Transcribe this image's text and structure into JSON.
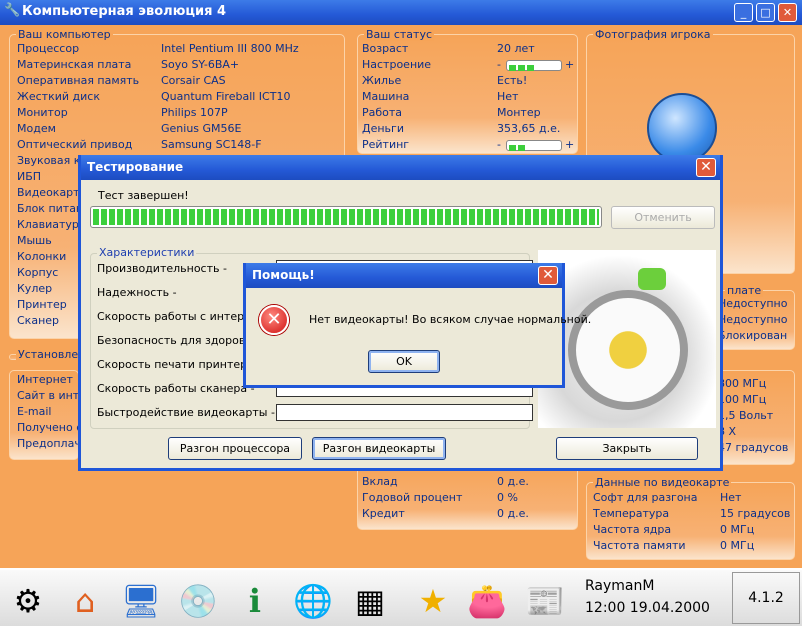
{
  "app": {
    "title": "Компьютерная эволюция 4"
  },
  "computer": {
    "title": "Ваш компьютер",
    "items": [
      {
        "label": "Процессор",
        "value": "Intel Pentium III 800 MHz"
      },
      {
        "label": "Материнская плата",
        "value": "Soyo SY-6BA+"
      },
      {
        "label": "Оперативная память",
        "value": "Corsair CAS"
      },
      {
        "label": "Жесткий диск",
        "value": "Quantum Fireball ICT10"
      },
      {
        "label": "Монитор",
        "value": "Philips 107P"
      },
      {
        "label": "Модем",
        "value": "Genius GM56E"
      },
      {
        "label": "Оптический привод",
        "value": "Samsung SC148-F"
      },
      {
        "label": "Звуковая ка",
        "value": ""
      },
      {
        "label": "ИБП",
        "value": ""
      },
      {
        "label": "Видеокарта",
        "value": ""
      },
      {
        "label": "Блок питан",
        "value": ""
      },
      {
        "label": "Клавиатура",
        "value": ""
      },
      {
        "label": "Мышь",
        "value": ""
      },
      {
        "label": "Колонки",
        "value": ""
      },
      {
        "label": "Корпус",
        "value": ""
      },
      {
        "label": "Кулер",
        "value": ""
      },
      {
        "label": "Принтер",
        "value": ""
      },
      {
        "label": "Сканер",
        "value": ""
      }
    ]
  },
  "installed": {
    "title": "Установлен"
  },
  "internet": {
    "items": [
      "Интернет",
      "Сайт в инте",
      "E-mail",
      "Получено с",
      "Предоплач"
    ]
  },
  "status": {
    "title": "Ваш статус",
    "items": [
      {
        "label": "Возраст",
        "value": "20 лет"
      },
      {
        "label": "Настроение",
        "bar": 3
      },
      {
        "label": "Жилье",
        "value": "Есть!"
      },
      {
        "label": "Машина",
        "value": "Нет"
      },
      {
        "label": "Работа",
        "value": "Монтер"
      },
      {
        "label": "Деньги",
        "value": "353,65 д.е."
      },
      {
        "label": "Рейтинг",
        "bar": 2
      }
    ],
    "minus": "-",
    "plus": "+"
  },
  "photo": {
    "title": "Фотография игрока"
  },
  "board": {
    "title": "плате",
    "values": [
      "Недоступно",
      "Недоступно",
      "Блокирован"
    ]
  },
  "cpu": {
    "values": [
      "800 МГц",
      "100 МГц",
      "1,5 Вольт",
      "8 X",
      "47 градусов"
    ]
  },
  "bank": {
    "items": [
      {
        "label": "Вклад",
        "value": "0 д.е."
      },
      {
        "label": "Годовой процент",
        "value": "0 %"
      },
      {
        "label": "Кредит",
        "value": "0 д.е."
      }
    ]
  },
  "video": {
    "title": "Данные по видеокарте",
    "items": [
      {
        "label": "Софт для разгона",
        "value": "Нет"
      },
      {
        "label": "Температура",
        "value": "15 градусов"
      },
      {
        "label": "Частота ядра",
        "value": "0 МГц"
      },
      {
        "label": "Частота памяти",
        "value": "0 МГц"
      }
    ]
  },
  "test": {
    "title": "Тестирование",
    "status": "Тест завершен!",
    "progress": 100,
    "cancel": "Отменить",
    "group": "Характеристики",
    "fields": [
      "Производительность -",
      "Надежность -",
      "Скорость работы с интернет",
      "Безопасность для здоровья",
      "Скорость печати принтера -",
      "Скорость работы сканера -",
      "Быстродействие видеокарты -"
    ],
    "btn_cpu": "Разгон процессора",
    "btn_video": "Разгон видеокарты",
    "btn_close": "Закрыть"
  },
  "help": {
    "title": "Помощь!",
    "message": "Нет видеокарты! Во всяком случае нормальной.",
    "ok": "OK"
  },
  "taskbar": {
    "user": "RaymanM",
    "datetime": "12:00 19.04.2000",
    "version": "4.1.2"
  }
}
